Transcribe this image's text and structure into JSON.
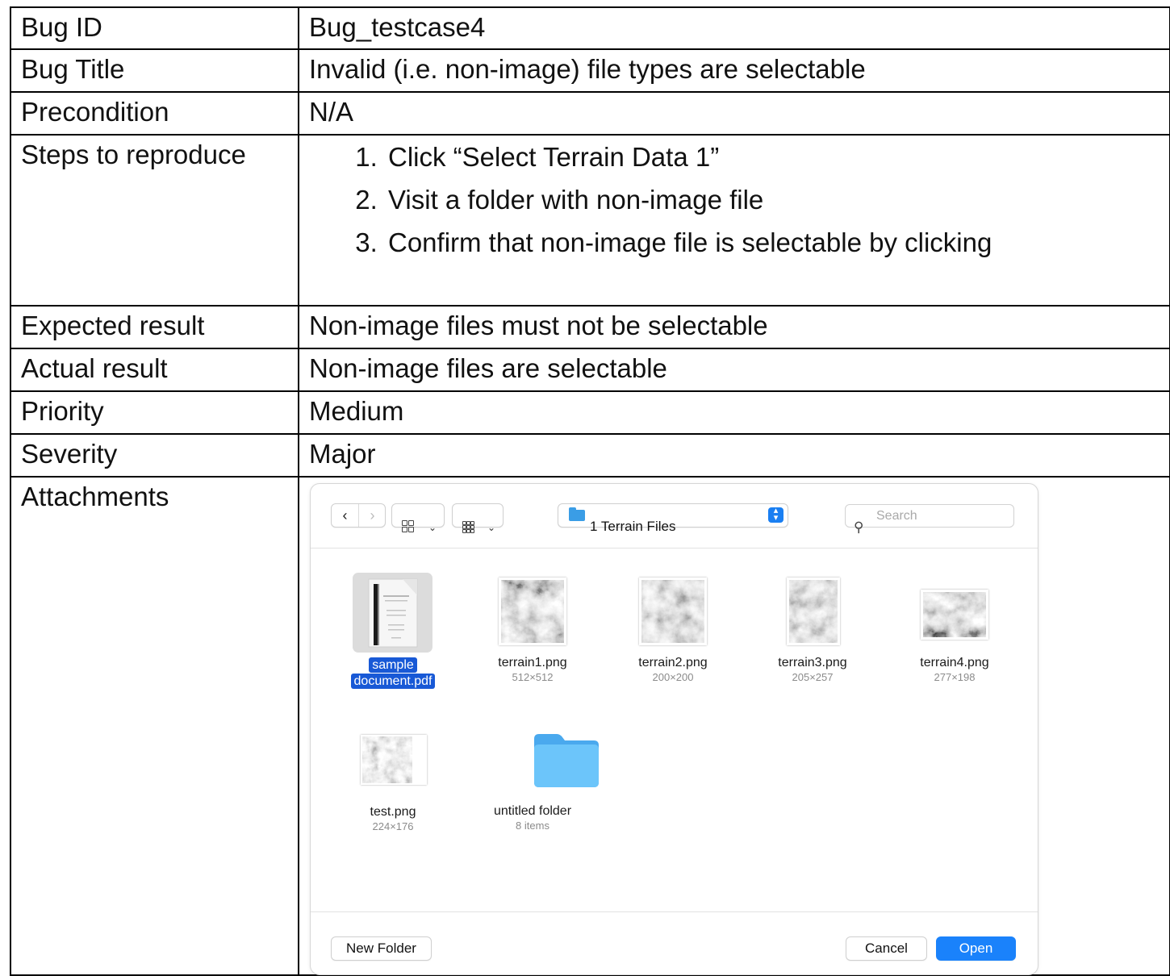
{
  "rows": {
    "bug_id": {
      "label": "Bug ID",
      "value": "Bug_testcase4"
    },
    "bug_title": {
      "label": "Bug Title",
      "value": "Invalid (i.e. non-image) file types are selectable"
    },
    "precondition": {
      "label": "Precondition",
      "value": "N/A"
    },
    "steps": {
      "label": "Steps to reproduce",
      "items": [
        "Click “Select Terrain Data 1”",
        "Visit a folder with non-image file",
        "Confirm that non-image file is selectable by clicking"
      ]
    },
    "expected": {
      "label": "Expected result",
      "value": "Non-image files must not be selectable"
    },
    "actual": {
      "label": "Actual result",
      "value": "Non-image files are selectable"
    },
    "priority": {
      "label": "Priority",
      "value": "Medium"
    },
    "severity": {
      "label": "Severity",
      "value": "Major"
    },
    "attachments": {
      "label": "Attachments"
    }
  },
  "dialog": {
    "location": "1 Terrain Files",
    "search_placeholder": "Search",
    "files": [
      {
        "name_line1": "sample",
        "name_line2": "document.pdf",
        "selected": true,
        "icon": "pdf-document-icon"
      },
      {
        "name": "terrain1.png",
        "meta": "512×512"
      },
      {
        "name": "terrain2.png",
        "meta": "200×200"
      },
      {
        "name": "terrain3.png",
        "meta": "205×257"
      },
      {
        "name": "terrain4.png",
        "meta": "277×198"
      },
      {
        "name": "test.png",
        "meta": "224×176"
      },
      {
        "name": "untitled folder",
        "meta": "8 items",
        "icon": "folder-icon"
      }
    ],
    "new_folder_label": "New Folder",
    "cancel_label": "Cancel",
    "open_label": "Open",
    "accent_color": "#1a82fb",
    "folder_color": "#5ab8f5"
  }
}
